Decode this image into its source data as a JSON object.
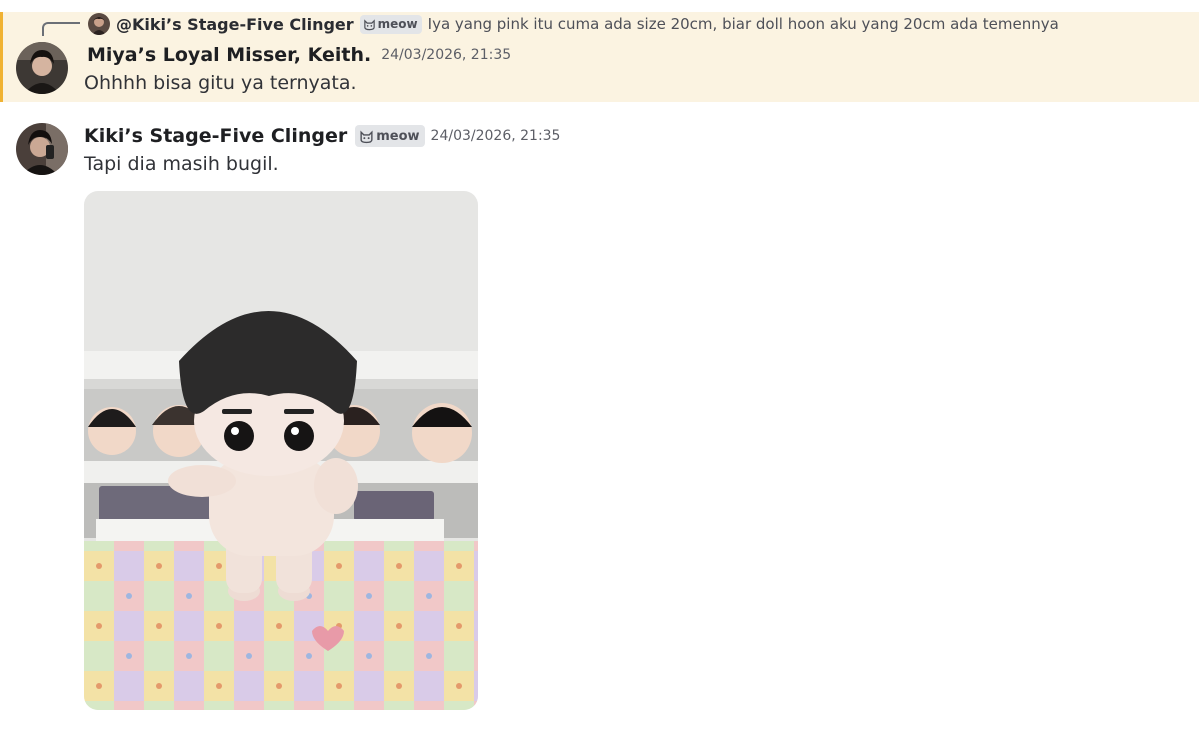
{
  "reply_reference": {
    "author": "@Kiki’s Stage-Five Clinger",
    "tag": "meow",
    "text": "Iya yang pink itu cuma ada size 20cm, biar doll hoon aku yang 20cm ada temennya"
  },
  "messages": [
    {
      "author": "Miya’s Loyal Misser, Keith.",
      "timestamp": "24/03/2026, 21:35",
      "text": "Ohhhh bisa gitu ya ternyata.",
      "highlighted": true
    },
    {
      "author": "Kiki’s Stage-Five Clinger",
      "tag": "meow",
      "timestamp": "24/03/2026, 21:35",
      "text": "Tapi dia masih bugil.",
      "attachment": "photo of a plush doll standing on a patchwork quilt in front of a shelf of plushies"
    }
  ],
  "colors": {
    "highlight_bg": "#fbf3e1",
    "highlight_bar": "#f0b232",
    "tag_bg": "#e3e5e8"
  }
}
